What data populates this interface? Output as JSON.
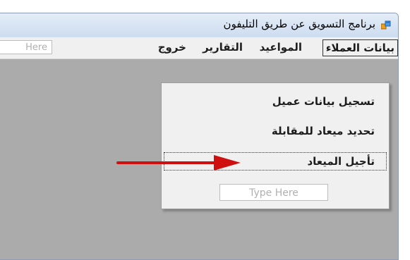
{
  "window": {
    "title": "برنامج التسويق عن طريق التليفون",
    "icon": "app-form-icon"
  },
  "menubar": {
    "items": [
      {
        "label": "بيانات العملاء"
      },
      {
        "label": "المواعيد"
      },
      {
        "label": "التقارير"
      },
      {
        "label": "خروج"
      }
    ],
    "type_here": "Here"
  },
  "dropdown": {
    "items": [
      {
        "label": "تسجيل بيانات عميل"
      },
      {
        "label": "تحديد ميعاد للمقابلة"
      },
      {
        "label": "تأجيل الميعاد"
      }
    ],
    "type_here": "Type Here"
  },
  "annotation": {
    "icon": "red-arrow-icon",
    "color": "#d01010"
  }
}
